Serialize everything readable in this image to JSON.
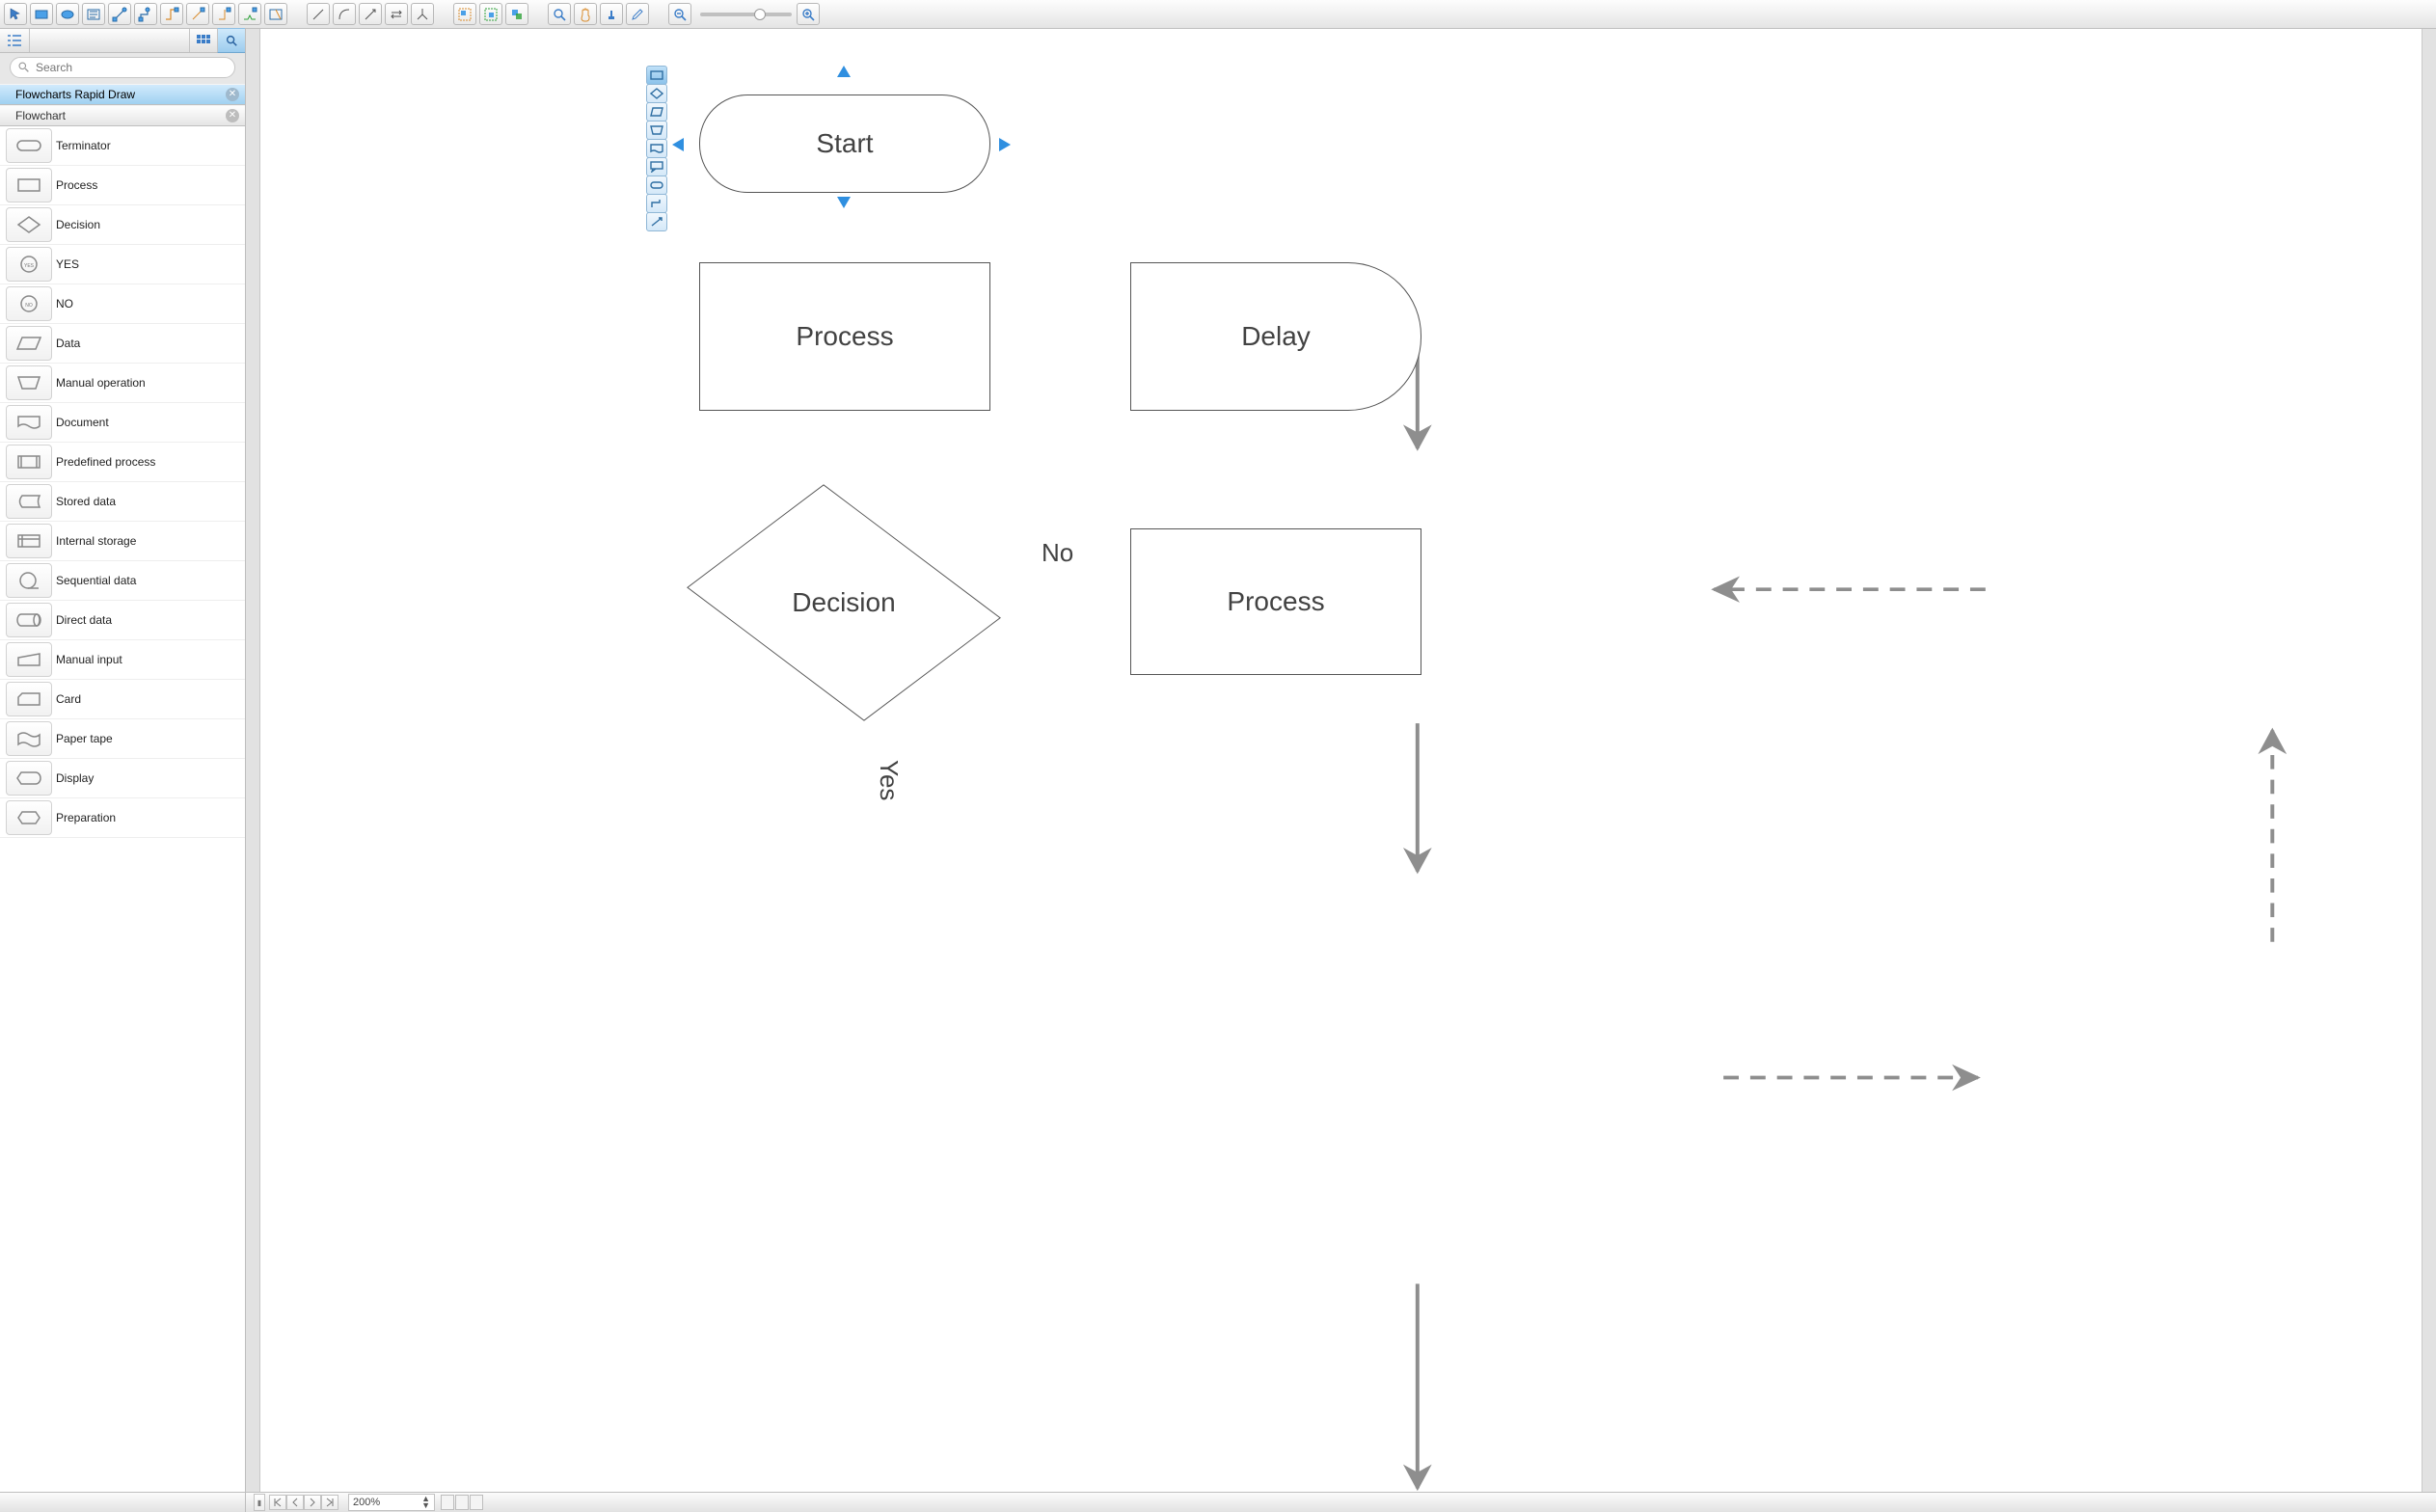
{
  "search": {
    "placeholder": "Search"
  },
  "libs": {
    "rapid": "Flowcharts Rapid Draw",
    "flow": "Flowchart"
  },
  "shapes": [
    {
      "k": "terminator",
      "label": "Terminator"
    },
    {
      "k": "process",
      "label": "Process"
    },
    {
      "k": "decision",
      "label": "Decision"
    },
    {
      "k": "yes",
      "label": "YES"
    },
    {
      "k": "no",
      "label": "NO"
    },
    {
      "k": "data",
      "label": "Data"
    },
    {
      "k": "manualop",
      "label": "Manual operation"
    },
    {
      "k": "document",
      "label": "Document"
    },
    {
      "k": "predef",
      "label": "Predefined process"
    },
    {
      "k": "stored",
      "label": "Stored data"
    },
    {
      "k": "internal",
      "label": "Internal storage"
    },
    {
      "k": "seqdata",
      "label": "Sequential data"
    },
    {
      "k": "directdata",
      "label": "Direct data"
    },
    {
      "k": "manualin",
      "label": "Manual input"
    },
    {
      "k": "card",
      "label": "Card"
    },
    {
      "k": "papertape",
      "label": "Paper tape"
    },
    {
      "k": "display",
      "label": "Display"
    },
    {
      "k": "preparation",
      "label": "Preparation"
    }
  ],
  "diagram": {
    "start": "Start",
    "process": "Process",
    "delay": "Delay",
    "decision": "Decision",
    "process2": "Process",
    "edge_no": "No",
    "edge_yes": "Yes"
  },
  "status": {
    "zoom": "200%"
  },
  "zoom_slider": "67"
}
